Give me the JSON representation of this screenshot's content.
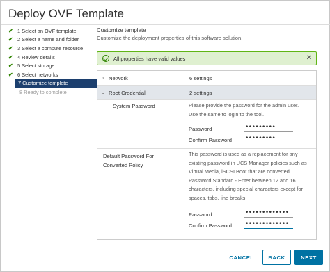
{
  "window": {
    "title": "Deploy OVF Template"
  },
  "steps": [
    {
      "label": "1 Select an OVF template",
      "state": "done"
    },
    {
      "label": "2 Select a name and folder",
      "state": "done"
    },
    {
      "label": "3 Select a compute resource",
      "state": "done"
    },
    {
      "label": "4 Review details",
      "state": "done"
    },
    {
      "label": "5 Select storage",
      "state": "done"
    },
    {
      "label": "6 Select networks",
      "state": "done"
    },
    {
      "label": "7 Customize template",
      "state": "active"
    },
    {
      "label": "8 Ready to complete",
      "state": "pending"
    }
  ],
  "content": {
    "title": "Customize template",
    "subtitle": "Customize the deployment properties of this software solution."
  },
  "alert": {
    "text": "All properties have valid values",
    "color": "#60b515"
  },
  "network": {
    "name": "Network",
    "value": "6 settings"
  },
  "root_credential": {
    "name": "Root Credential",
    "value": "2 settings"
  },
  "system_password": {
    "label": "System Password",
    "description_lines": [
      "Please provide the password for the admin user.",
      "Use the same to login to the tool."
    ],
    "password_label": "Password",
    "password_value": "•••••••••",
    "confirm_label": "Confirm Password",
    "confirm_value": "•••••••••"
  },
  "default_password": {
    "label_lines": [
      "Default Password For",
      "Converted Policy"
    ],
    "description_lines": [
      "This password is used as a replacement for any",
      "existing password in UCS Manager policies such as",
      "Virtual Media, iSCSI Boot that are converted.",
      "Password Standard - Enter between 12 and 16",
      "characters, including special characters except for",
      "spaces, tabs, line breaks."
    ],
    "password_label": "Password",
    "password_value": "•••••••••••••",
    "confirm_label": "Confirm Password",
    "confirm_value": "•••••••••••••"
  },
  "buttons": {
    "cancel": "CANCEL",
    "back": "BACK",
    "next": "NEXT"
  },
  "colors": {
    "accent": "#0072a3",
    "active_step": "#1c3f6e",
    "check": "#2f8400"
  }
}
